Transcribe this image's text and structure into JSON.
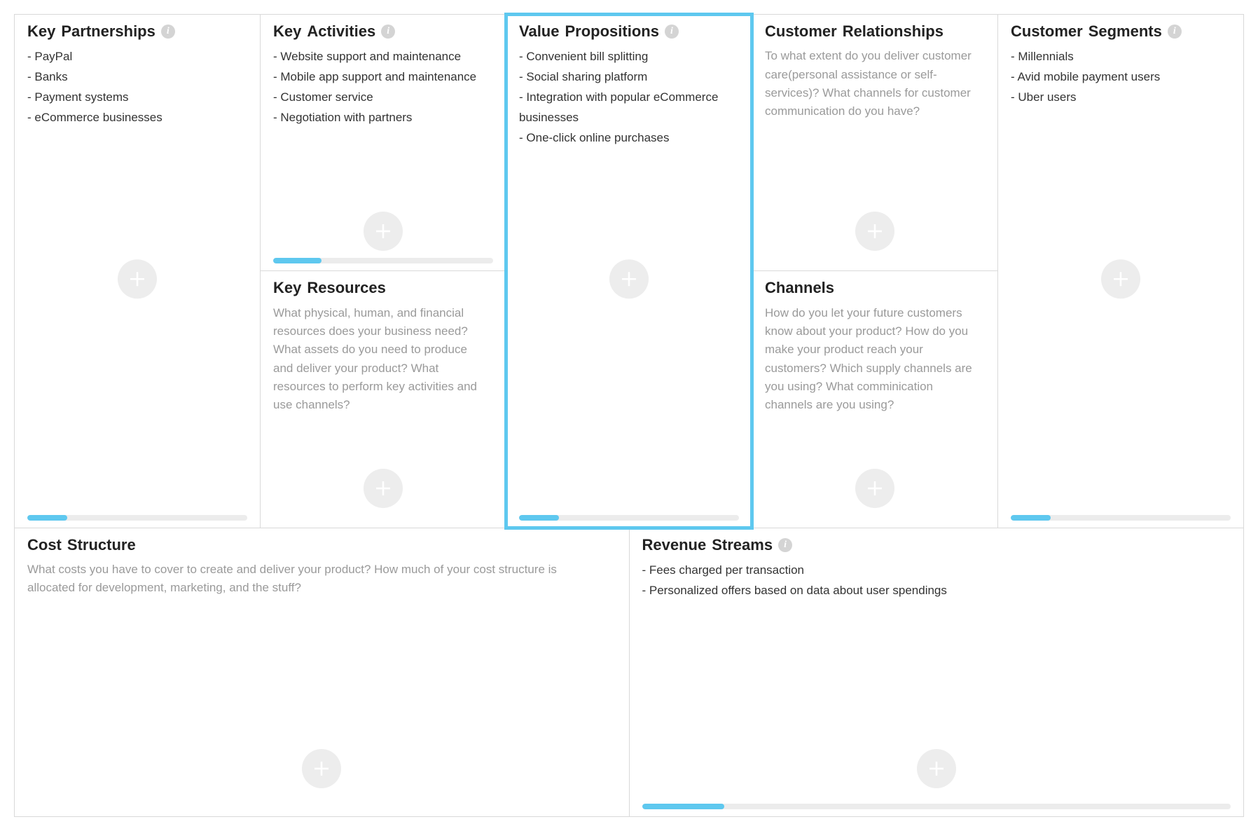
{
  "blocks": {
    "key_partnerships": {
      "title1": "Key",
      "title2": "Partnerships",
      "info": true,
      "items": [
        "PayPal",
        "Banks",
        "Payment systems",
        "eCommerce businesses"
      ],
      "progress": 18
    },
    "key_activities": {
      "title1": "Key",
      "title2": "Activities",
      "info": true,
      "items": [
        "Website support and maintenance",
        "Mobile app support and maintenance",
        "Customer service",
        "Negotiation with partners"
      ],
      "progress": 22
    },
    "key_resources": {
      "title1": "Key",
      "title2": "Resources",
      "info": false,
      "prompt": "What physical, human, and financial resources does your business need?\nWhat assets do you need to produce and deliver your product?\nWhat resources to perform key activities and use channels?"
    },
    "value_propositions": {
      "title1": "Value",
      "title2": "Propositions",
      "info": true,
      "selected": true,
      "items": [
        "Convenient bill splitting",
        "Social sharing platform",
        "Integration with popular eCommerce businesses",
        "One-click online purchases"
      ],
      "progress": 18
    },
    "customer_relationships": {
      "title1": "Customer",
      "title2": "Relationships",
      "info": false,
      "prompt": "To what extent do you deliver customer care(personal assistance or self-services)?\nWhat channels for customer communication do you have?"
    },
    "channels": {
      "title1": "Channels",
      "title2": "",
      "info": false,
      "prompt": "How do you let your future customers know about your product?\nHow do you make your product reach your customers?\nWhich supply channels are you using?\nWhat comminication channels are you using?"
    },
    "customer_segments": {
      "title1": "Customer",
      "title2": "Segments",
      "info": true,
      "items": [
        "Millennials",
        "Avid mobile payment users",
        "Uber users"
      ],
      "progress": 18
    },
    "cost_structure": {
      "title1": "Cost",
      "title2": "Structure",
      "info": false,
      "prompt": "What costs you have to cover to create and deliver your product?\nHow much of your cost structure is allocated for development, marketing, and the stuff?"
    },
    "revenue_streams": {
      "title1": "Revenue",
      "title2": "Streams",
      "info": true,
      "items": [
        "Fees charged per transaction",
        "Personalized offers based on data about user spendings"
      ],
      "progress": 14
    }
  }
}
